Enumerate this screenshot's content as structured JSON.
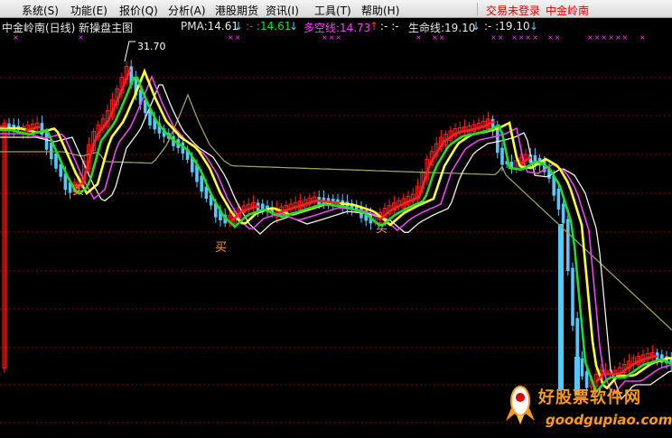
{
  "menu": {
    "items": [
      "系统(S)",
      "功能(E)",
      "报价(Q)",
      "分析(A)",
      "港股期货",
      "资讯(I)",
      "工具(T)",
      "帮助(H)"
    ],
    "status_trade": "交易未登录",
    "status_broker": "中金岭南"
  },
  "info": {
    "stock_title": "中金岭南(日线) 新操盘主图",
    "pma_label": "PMA:14.61",
    "pma_arrow": "↓",
    "dash1": ":-",
    "v2": ":14.61",
    "v2_arrow": "↓",
    "duokong_label": "多空线:14.73",
    "duokong_arrow": "↑",
    "dash2": ":-  :-",
    "shengming_label": "生命线:19.10",
    "shengming_arrow": "↓",
    "dash3": ":-  :19.10",
    "v3_arrow": "↓"
  },
  "chart": {
    "high_label": "31.70",
    "buy_labels": [
      "买",
      "买",
      "买"
    ],
    "colors": {
      "up": "#ff2020",
      "down": "#54c8ff",
      "yellow": "#ffff33",
      "green": "#22dd22",
      "magenta": "#ee44ee",
      "white": "#f0f0f0",
      "olive": "#9aa060",
      "grid": "#8b0000"
    }
  },
  "logo": {
    "name": "好股票软件网",
    "url": "goodgupiao.com"
  }
}
